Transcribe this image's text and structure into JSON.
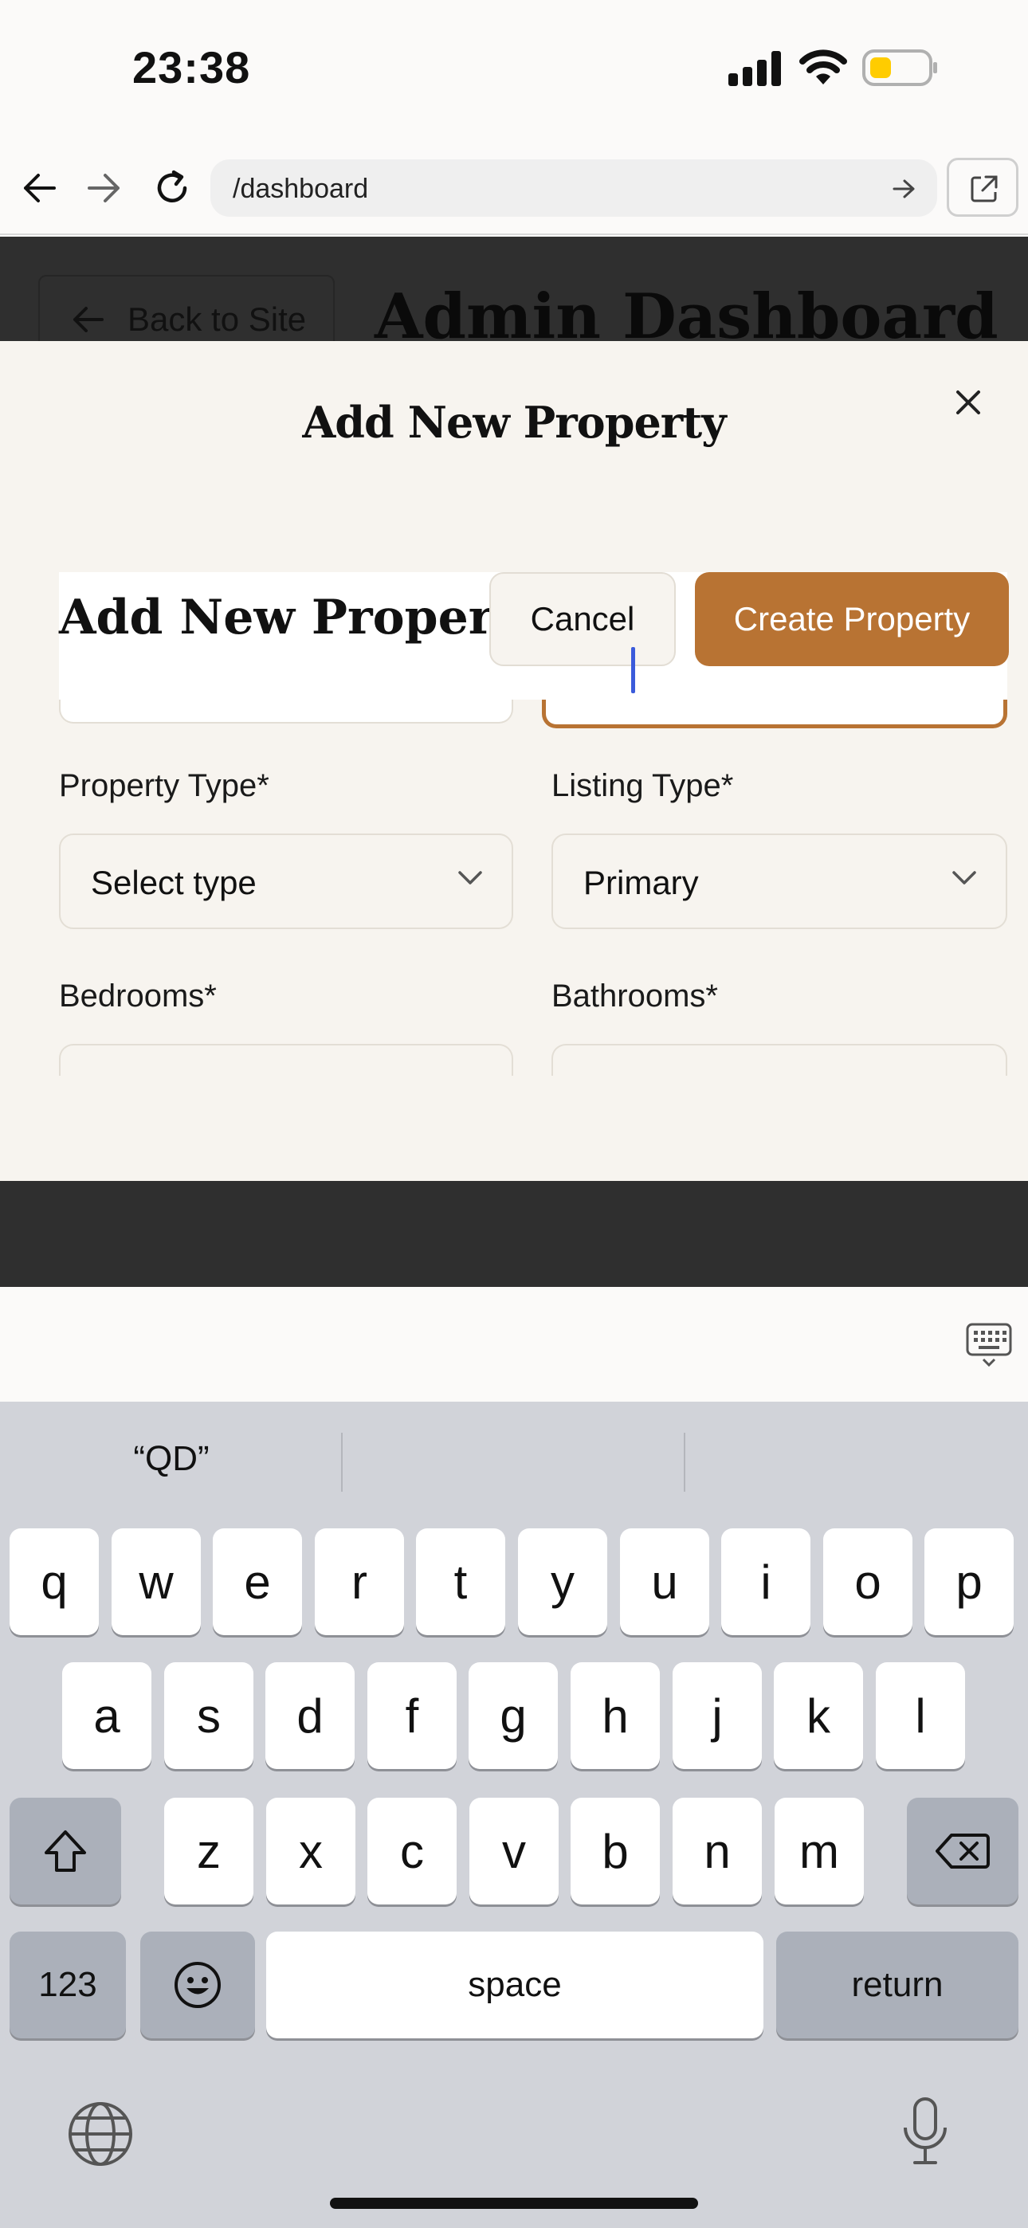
{
  "status_bar": {
    "time": "23:38"
  },
  "browser": {
    "url": "/dashboard"
  },
  "dashboard": {
    "back_label": "Back to Site",
    "title": "Admin Dashboard"
  },
  "modal": {
    "title": "Add New Property",
    "sticky_title": "Add New Property",
    "cancel_label": "Cancel",
    "create_label": "Create Property",
    "accent_color": "#b87333",
    "fields": {
      "property_type": {
        "label": "Property Type*",
        "value": "Select type"
      },
      "listing_type": {
        "label": "Listing Type*",
        "value": "Primary"
      },
      "bedrooms": {
        "label": "Bedrooms*"
      },
      "bathrooms": {
        "label": "Bathrooms*"
      }
    }
  },
  "keyboard": {
    "suggestion": "“QD”",
    "row1": [
      "q",
      "w",
      "e",
      "r",
      "t",
      "y",
      "u",
      "i",
      "o",
      "p"
    ],
    "row2": [
      "a",
      "s",
      "d",
      "f",
      "g",
      "h",
      "j",
      "k",
      "l"
    ],
    "row3": [
      "z",
      "x",
      "c",
      "v",
      "b",
      "n",
      "m"
    ],
    "numbers_label": "123",
    "space_label": "space",
    "return_label": "return"
  }
}
